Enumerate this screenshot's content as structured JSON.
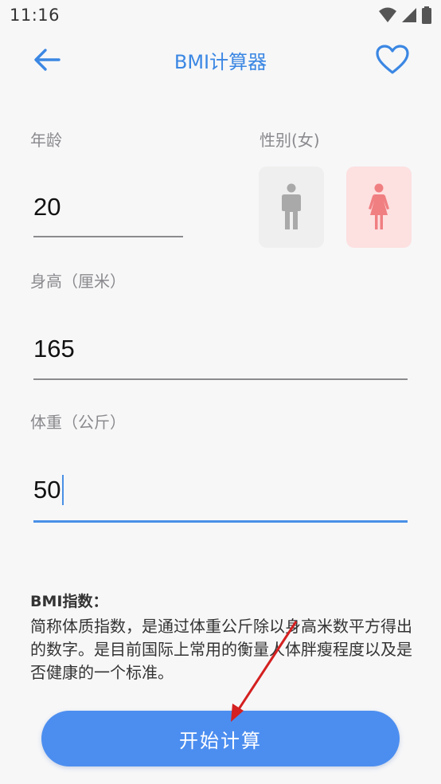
{
  "status_bar": {
    "time": "11:16"
  },
  "header": {
    "title": "BMI计算器",
    "back_icon": "arrow-left-icon",
    "favorite_icon": "heart-icon"
  },
  "form": {
    "age": {
      "label": "年龄",
      "value": "20"
    },
    "gender": {
      "label": "性别(女)",
      "selected": "female"
    },
    "height": {
      "label": "身高（厘米）",
      "value": "165"
    },
    "weight": {
      "label": "体重（公斤）",
      "value": "50"
    }
  },
  "bmi_info": {
    "title": "BMI指数：",
    "description": "简称体质指数，是通过体重公斤除以身高米数平方得出的数字。是目前国际上常用的衡量人体胖瘦程度以及是否健康的一个标准。"
  },
  "action": {
    "start_label": "开始计算"
  },
  "colors": {
    "accent": "#3b87e3",
    "button": "#4c8ef0",
    "female_bg": "#fde0e0",
    "female_icon": "#f07f82",
    "male_icon": "#a9a9a9",
    "arrow": "#d42020"
  }
}
